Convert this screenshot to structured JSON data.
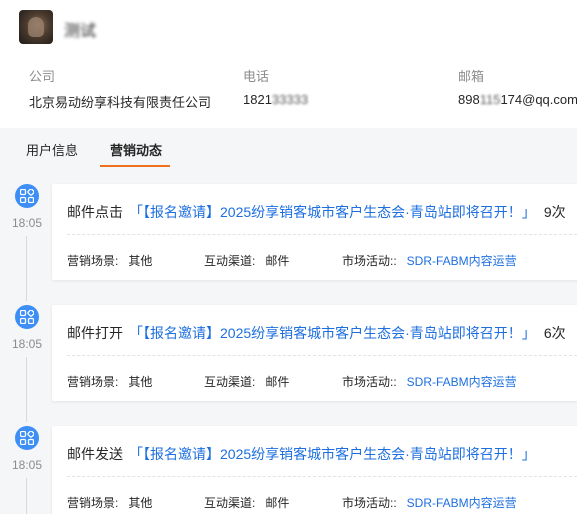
{
  "profile": {
    "name": "测试",
    "company_label": "公司",
    "company_value": "北京易动纷享科技有限责任公司",
    "phone_label": "电话",
    "phone_value": "1821",
    "phone_hidden": "33333",
    "email_label": "邮箱",
    "email_prefix": "898",
    "email_hidden": "115",
    "email_suffix": "174@qq.com"
  },
  "tabs": [
    {
      "label": "用户信息",
      "active": false
    },
    {
      "label": "营销动态",
      "active": true
    }
  ],
  "accent_color": "#f0701d",
  "link_color": "#1d6fe0",
  "timeline": [
    {
      "icon": "grid-apps-icon",
      "time": "18:05",
      "event": "邮件点击",
      "title": "「【报名邀请】2025纷享销客城市客户生态会·青岛站即将召开！」",
      "count": "9次",
      "scene_label": "营销场景:",
      "scene_value": "其他",
      "channel_label": "互动渠道:",
      "channel_value": "邮件",
      "activity_label": "市场活动::",
      "activity_value": "SDR-FABM内容运营"
    },
    {
      "icon": "grid-apps-icon",
      "time": "18:05",
      "event": "邮件打开",
      "title": "「【报名邀请】2025纷享销客城市客户生态会·青岛站即将召开！」",
      "count": "6次",
      "scene_label": "营销场景:",
      "scene_value": "其他",
      "channel_label": "互动渠道:",
      "channel_value": "邮件",
      "activity_label": "市场活动::",
      "activity_value": "SDR-FABM内容运营"
    },
    {
      "icon": "grid-apps-icon",
      "time": "18:05",
      "event": "邮件发送",
      "title": "「【报名邀请】2025纷享销客城市客户生态会·青岛站即将召开！」",
      "count": "",
      "scene_label": "营销场景:",
      "scene_value": "其他",
      "channel_label": "互动渠道:",
      "channel_value": "邮件",
      "activity_label": "市场活动::",
      "activity_value": "SDR-FABM内容运营"
    }
  ]
}
